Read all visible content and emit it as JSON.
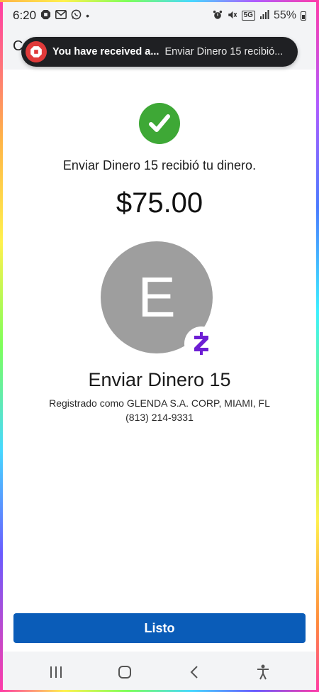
{
  "status_bar": {
    "time": "6:20",
    "network": "5G",
    "battery": "55%"
  },
  "app_header": {
    "letter": "C"
  },
  "notification": {
    "title": "You have received a...",
    "body": "Enviar Dinero 15 recibió...",
    "icon": "chase-octagon-icon",
    "icon_color": "#e03a3a"
  },
  "confirmation": {
    "message": "Enviar Dinero 15 recibió tu dinero.",
    "amount": "$75.00",
    "avatar_initial": "E",
    "recipient_name": "Enviar Dinero 15",
    "registered_as": "Registrado como GLENDA S.A. CORP, MIAMI, FL",
    "phone": "(813) 214-9331",
    "check_color": "#3ea836",
    "zelle_color": "#6d1ed4"
  },
  "actions": {
    "done_label": "Listo",
    "done_color": "#0a5cb8"
  },
  "nav_bar": {
    "items": [
      "recents-icon",
      "home-icon",
      "back-icon",
      "accessibility-icon"
    ]
  }
}
